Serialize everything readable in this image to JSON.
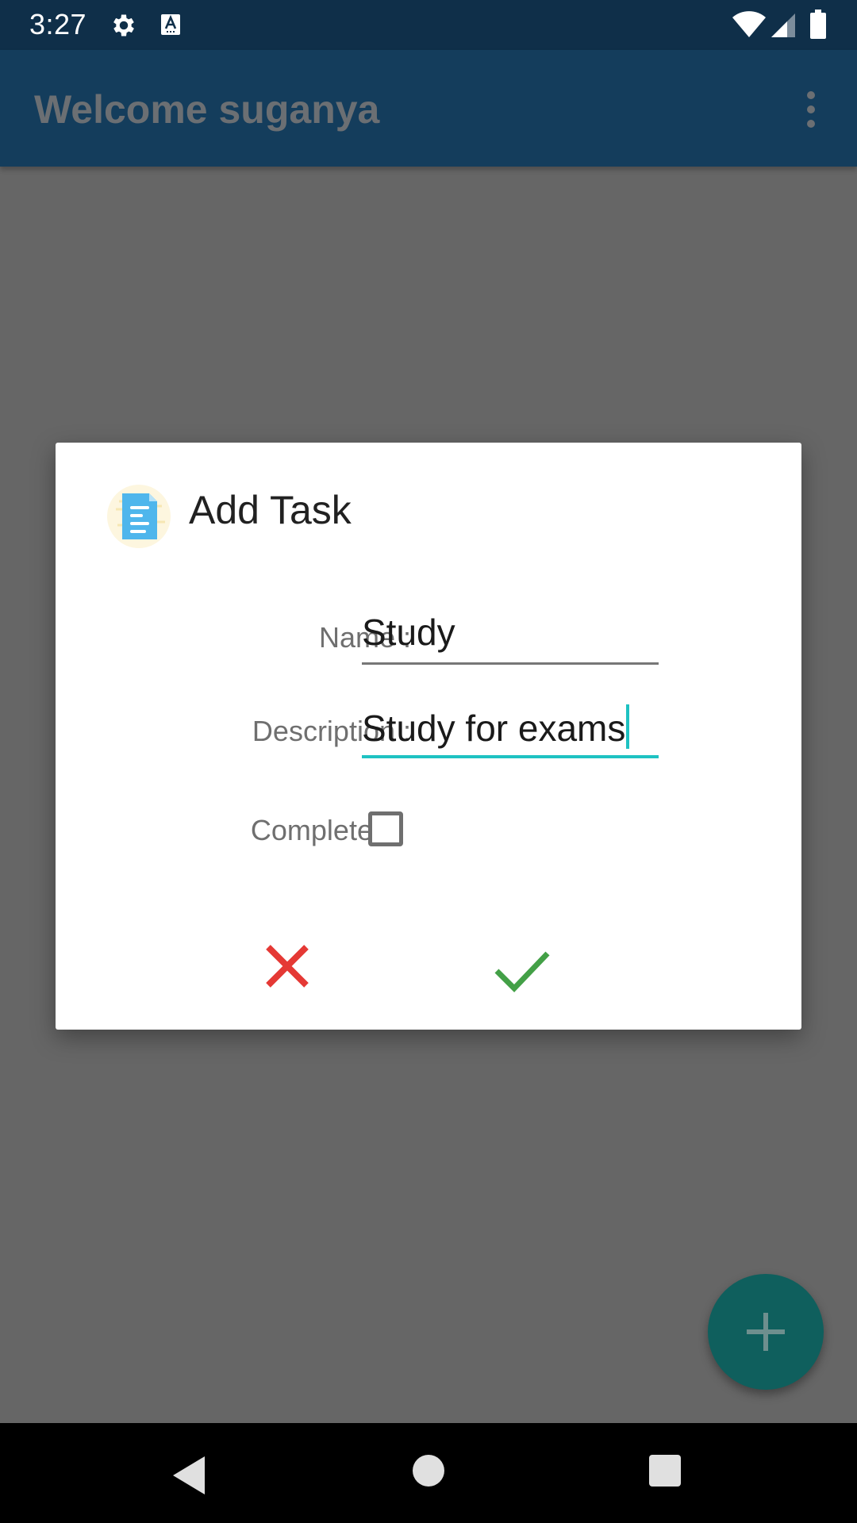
{
  "status_bar": {
    "time": "3:27",
    "icons": [
      "gear-icon",
      "a-keyboard-icon",
      "wifi-icon",
      "signal-icon",
      "battery-icon"
    ]
  },
  "app_bar": {
    "title": "Welcome suganya",
    "menu_icon": "overflow-menu-icon"
  },
  "dialog": {
    "title": "Add Task",
    "icon": "document-icon",
    "name_label": "Name :",
    "name_value": "Study",
    "description_label": "Description :",
    "description_value": "Study for exams",
    "completed_label": "Completed :",
    "completed_checked": false,
    "cancel_icon": "close-icon",
    "confirm_icon": "check-icon"
  },
  "fab": {
    "icon": "plus-icon"
  },
  "nav_bar": {
    "icons": [
      "back-icon",
      "home-icon",
      "recents-icon"
    ]
  },
  "colors": {
    "status_bar": "#0f2f49",
    "app_bar": "#143d5c",
    "scrim": "#666666",
    "accent": "#1ec2c2",
    "cancel": "#e53935",
    "confirm": "#43a047",
    "fab": "#0f5f5d"
  }
}
